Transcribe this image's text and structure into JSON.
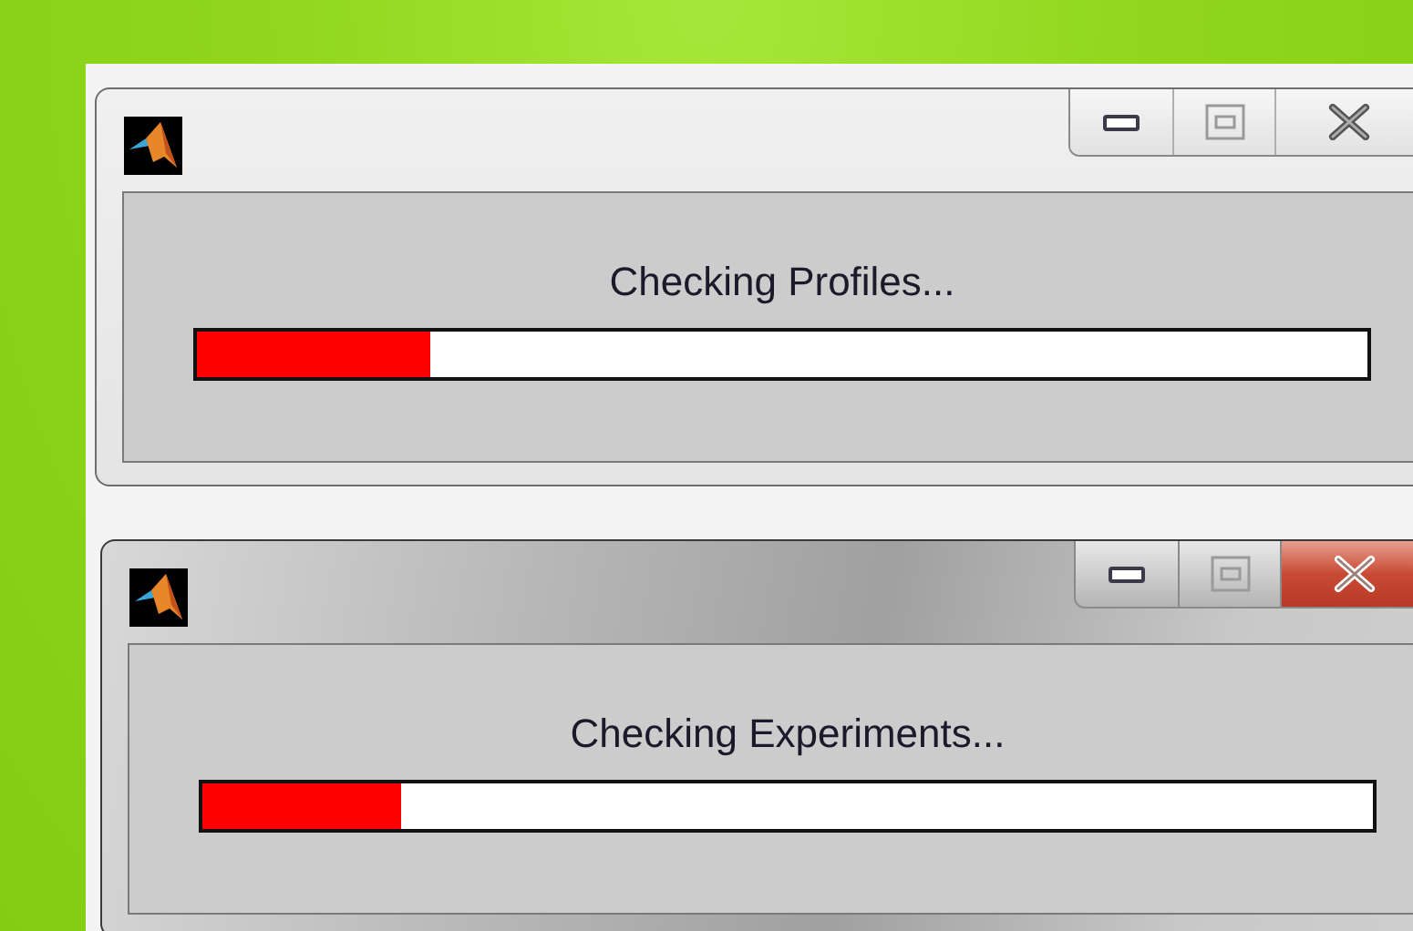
{
  "windows": [
    {
      "active": false,
      "message": "Checking Profiles...",
      "progress": {
        "level": 0.2
      }
    },
    {
      "active": true,
      "message": "Checking Experiments...",
      "progress": {
        "level": 0.17
      }
    }
  ]
}
